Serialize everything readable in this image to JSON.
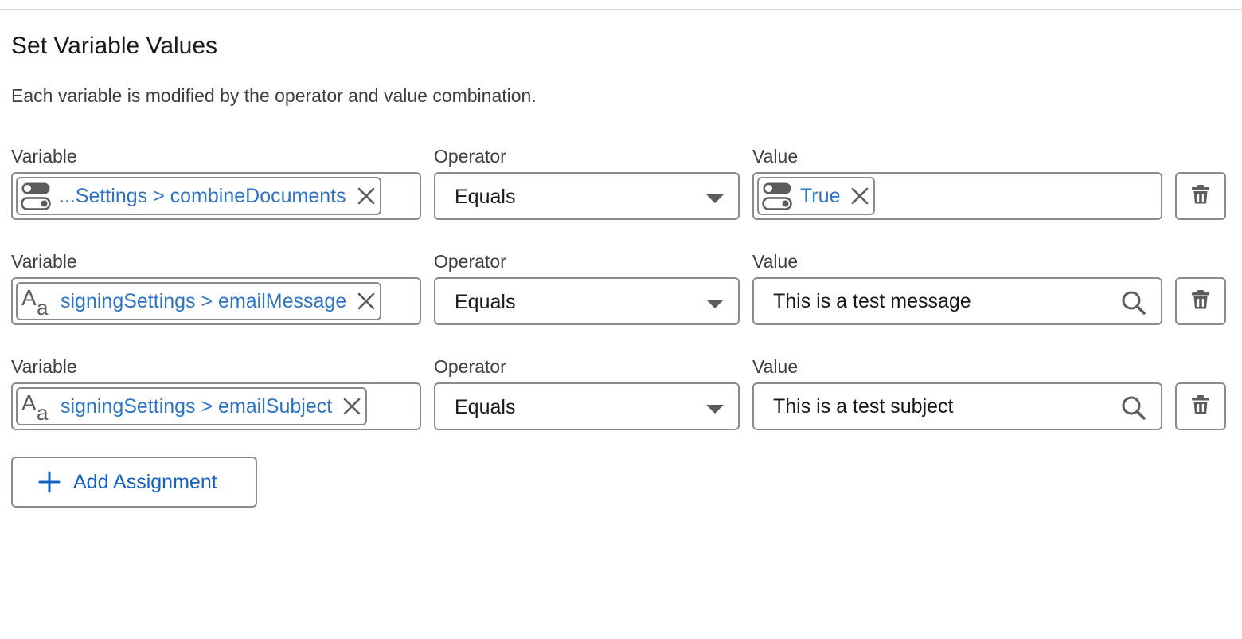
{
  "section": {
    "title": "Set Variable Values",
    "description": "Each variable is modified by the operator and value combination."
  },
  "labels": {
    "variable": "Variable",
    "operator": "Operator",
    "value": "Value"
  },
  "assignments": [
    {
      "variable": {
        "icon": "toggle-icon",
        "text": "...Settings > combineDocuments"
      },
      "operator": "Equals",
      "value": {
        "type": "pill",
        "icon": "toggle-icon",
        "text": "True"
      }
    },
    {
      "variable": {
        "icon": "text-type-icon",
        "text": "signingSettings > emailMessage"
      },
      "operator": "Equals",
      "value": {
        "type": "input",
        "text": "This is a test message"
      }
    },
    {
      "variable": {
        "icon": "text-type-icon",
        "text": "signingSettings > emailSubject"
      },
      "operator": "Equals",
      "value": {
        "type": "input",
        "text": "This is a test subject"
      }
    }
  ],
  "add_button": {
    "label": "Add Assignment",
    "icon": "plus-icon"
  },
  "colors": {
    "pill_text": "#2e74c4",
    "link_blue": "#1160c4",
    "border": "#8b8b8b",
    "icon_gray": "#5c5c5c"
  }
}
